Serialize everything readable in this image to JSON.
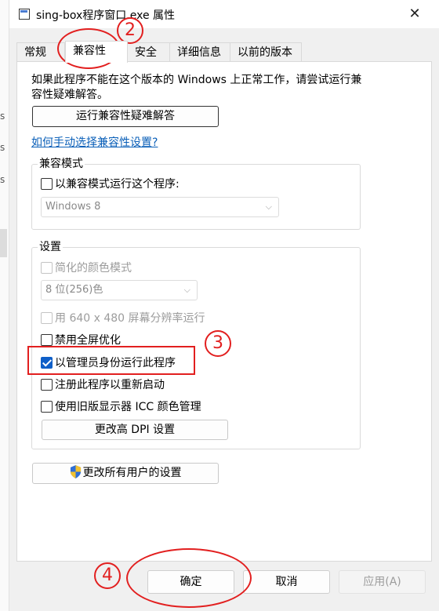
{
  "window": {
    "title": "sing-box程序窗口.exe 属性",
    "close_glyph": "✕"
  },
  "background_strip": [
    "s",
    "s",
    "s"
  ],
  "tabs": [
    {
      "label": "常规"
    },
    {
      "label": "兼容性",
      "active": true
    },
    {
      "label": "安全"
    },
    {
      "label": "详细信息"
    },
    {
      "label": "以前的版本"
    }
  ],
  "intro_text": "如果此程序不能在这个版本的 Windows 上正常工作，请尝试运行兼容性疑难解答。",
  "troubleshoot_button": "运行兼容性疑难解答",
  "manual_link": "如何手动选择兼容性设置?",
  "compat_mode": {
    "legend": "兼容模式",
    "checkbox_label": "以兼容模式运行这个程序:",
    "checked": false,
    "select_value": "Windows 8"
  },
  "settings": {
    "legend": "设置",
    "reduced_color": {
      "label": "简化的颜色模式",
      "disabled": true
    },
    "color_select_value": "8 位(256)色",
    "run_640": {
      "label": "用 640 x 480 屏幕分辨率运行",
      "disabled": true
    },
    "disable_fullscreen": {
      "label": "禁用全屏优化",
      "checked": false
    },
    "run_as_admin": {
      "label": "以管理员身份运行此程序",
      "checked": true
    },
    "register_restart": {
      "label": "注册此程序以重新启动",
      "checked": false
    },
    "legacy_icc": {
      "label": "使用旧版显示器 ICC 颜色管理",
      "checked": false
    },
    "high_dpi_button": "更改高 DPI 设置"
  },
  "all_users_button": "更改所有用户的设置",
  "footer": {
    "ok": "确定",
    "cancel": "取消",
    "apply": "应用(A)"
  },
  "annotations": {
    "n2": "2",
    "n3": "3",
    "n4": "4"
  },
  "colors": {
    "accent": "#0f5fc8",
    "annotation_red": "#e21f1f",
    "link": "#0a5fb8"
  }
}
